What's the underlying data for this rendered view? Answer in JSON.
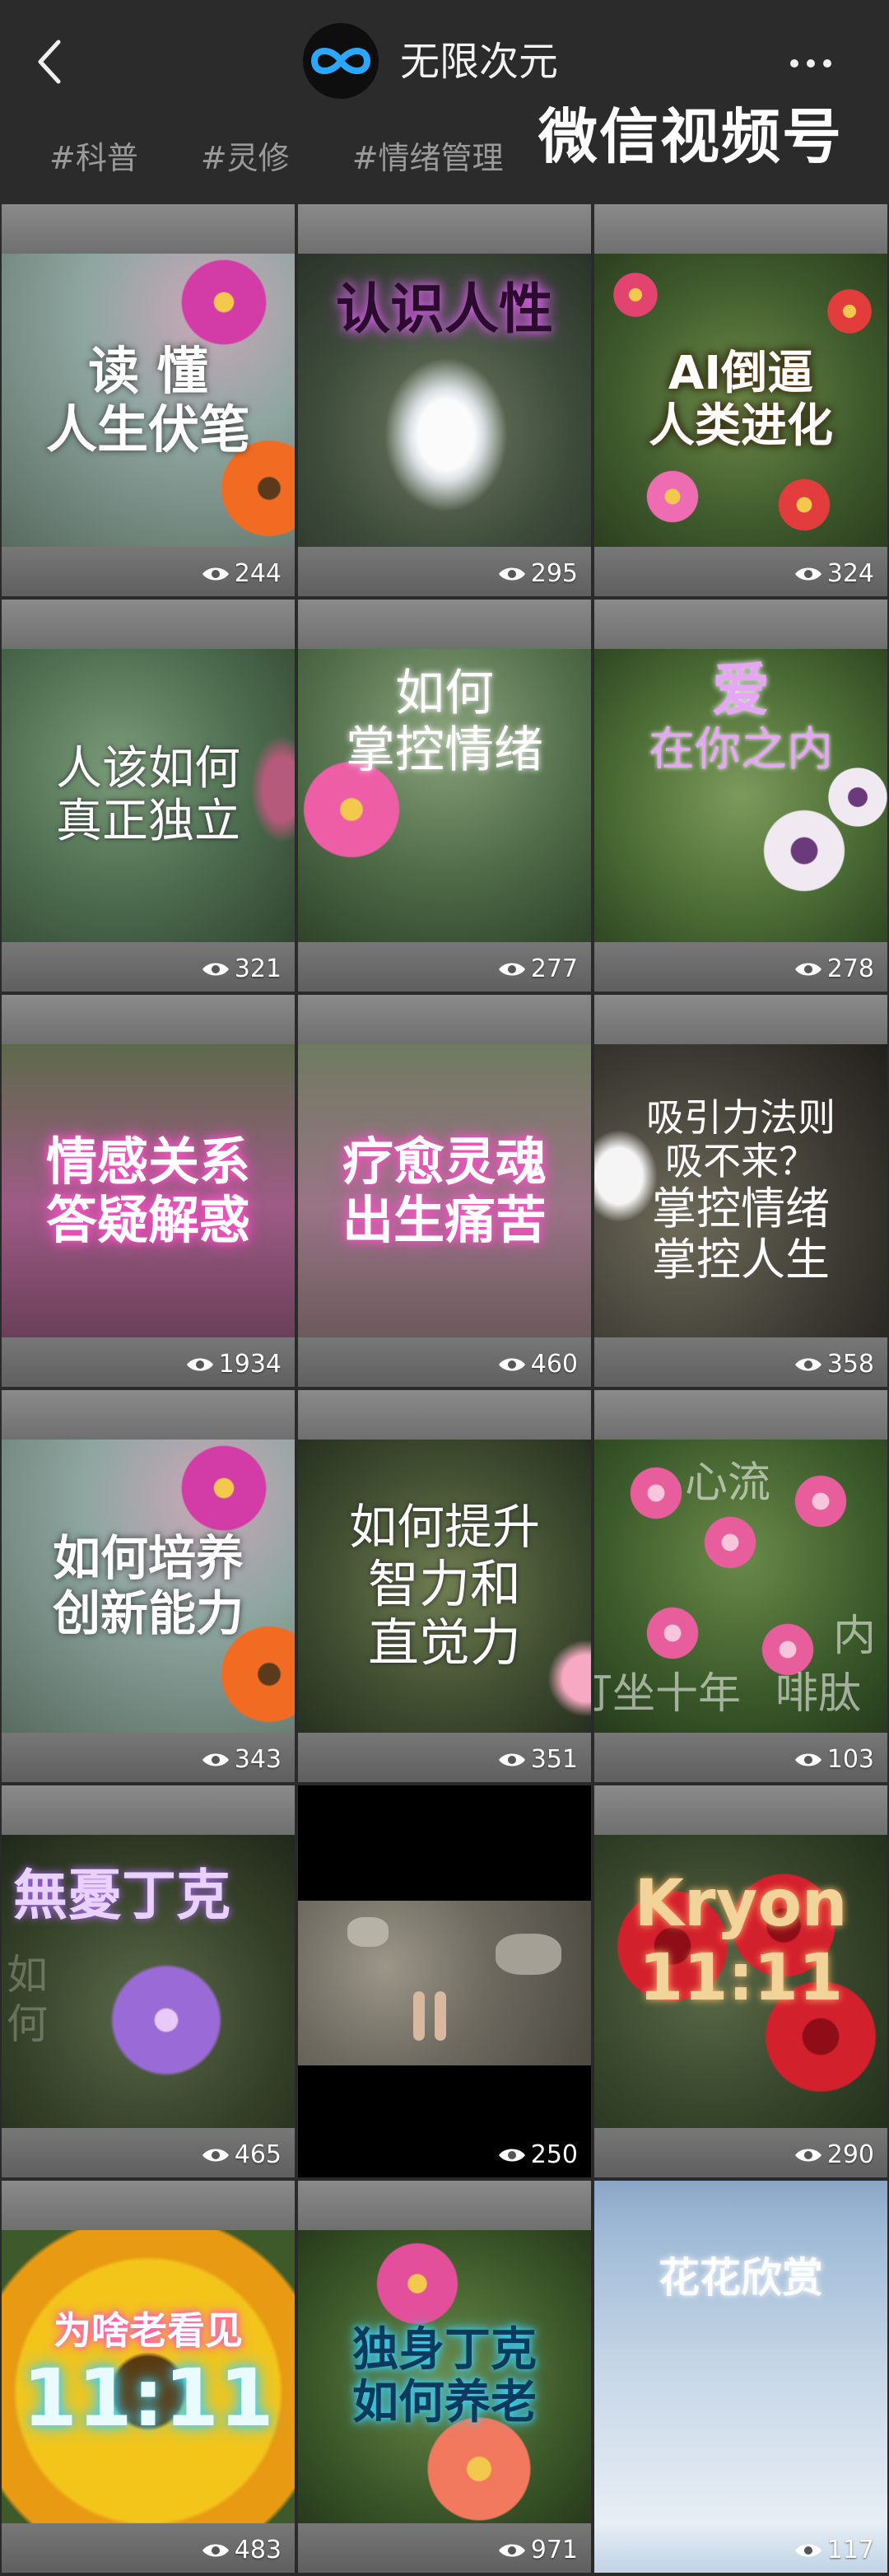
{
  "header": {
    "title": "无限次元",
    "watermark": "微信视频号",
    "tags": [
      "#科普",
      "#灵修",
      "#情绪管理"
    ]
  },
  "videos": [
    {
      "lines": [
        "读 懂",
        "人生伏笔"
      ],
      "views": "244"
    },
    {
      "lines": [
        "认识人性"
      ],
      "views": "295"
    },
    {
      "lines": [
        "AI倒逼",
        "人类进化"
      ],
      "views": "324"
    },
    {
      "lines": [
        "人该如何",
        "真正独立"
      ],
      "views": "321"
    },
    {
      "lines": [
        "如何",
        "掌控情绪"
      ],
      "views": "277"
    },
    {
      "lines": [
        "爱",
        "在你之内"
      ],
      "views": "278"
    },
    {
      "lines": [
        "情感关系",
        "答疑解惑"
      ],
      "views": "1934"
    },
    {
      "lines": [
        "疗愈灵魂",
        "出生痛苦"
      ],
      "views": "460"
    },
    {
      "lines": [
        "吸引力法则",
        "吸不来？",
        "掌控情绪",
        "掌控人生"
      ],
      "views": "358"
    },
    {
      "lines": [
        "如何培养",
        "创新能力"
      ],
      "views": "343"
    },
    {
      "lines": [
        "如何提升",
        "智力和",
        "直觉力"
      ],
      "views": "351"
    },
    {
      "lines": [
        "心流",
        "打坐十年",
        "内",
        "啡肽"
      ],
      "views": "103"
    },
    {
      "lines": [
        "無憂丁克",
        "如",
        "何"
      ],
      "views": "465"
    },
    {
      "lines": [],
      "views": "250"
    },
    {
      "lines": [
        "Kryon",
        "11:11"
      ],
      "views": "290"
    },
    {
      "lines": [
        "为啥老看见",
        "11:11"
      ],
      "views": "483"
    },
    {
      "lines": [
        "独身丁克",
        "如何养老"
      ],
      "views": "971"
    },
    {
      "lines": [
        "花花欣赏"
      ],
      "views": "117"
    }
  ]
}
